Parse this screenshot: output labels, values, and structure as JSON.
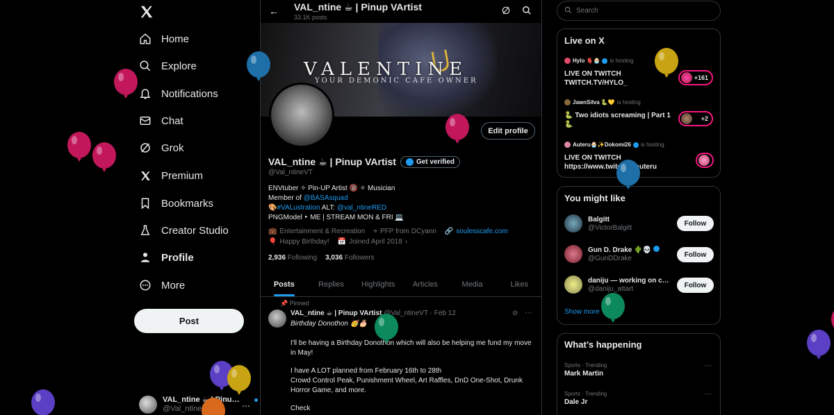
{
  "colors": {
    "accent": "#1d9bf0",
    "live": "#f91880",
    "bg": "#000000",
    "border": "#2f3336",
    "balloon_magenta": "#c2185b",
    "balloon_blue": "#1e6fa8",
    "balloon_yellow": "#c8a415",
    "balloon_green": "#0c8a5b",
    "balloon_purple": "#5b3fc4",
    "balloon_orange": "#d9691c"
  },
  "sidebar": {
    "logo_icon": "x-logo-icon",
    "items": [
      {
        "label": "Home",
        "icon": "home-icon"
      },
      {
        "label": "Explore",
        "icon": "search-icon"
      },
      {
        "label": "Notifications",
        "icon": "bell-icon"
      },
      {
        "label": "Chat",
        "icon": "mail-icon"
      },
      {
        "label": "Grok",
        "icon": "grok-icon"
      },
      {
        "label": "Premium",
        "icon": "x-logo-icon"
      },
      {
        "label": "Bookmarks",
        "icon": "bookmark-icon"
      },
      {
        "label": "Creator Studio",
        "icon": "flask-icon"
      },
      {
        "label": "Profile",
        "icon": "person-icon"
      },
      {
        "label": "More",
        "icon": "more-circle-icon"
      }
    ],
    "post_label": "Post",
    "account": {
      "name": "VAL_ntine ☕ | Pinu…",
      "handle": "@Val_ntineVT",
      "more": "⋯"
    }
  },
  "header": {
    "title": "VAL_ntine ☕ | Pinup VArtist",
    "subtitle": "33.1K posts",
    "back": "←"
  },
  "banner": {
    "title": "VALENTINE",
    "subtitle": "YOUR DEMONIC CAFE OWNER"
  },
  "profile": {
    "edit_label": "Edit profile",
    "name": "VAL_ntine ☕ | Pinup VArtist",
    "verify_label": "Get verified",
    "handle": "@Val_ntineVT",
    "bio": {
      "line1": "ENVtuber ✧ Pin-UP Artist 🔞 ✧ Musician",
      "line2_prefix": "Member of ",
      "line2_link": "@BASAsquad",
      "line3_icon": "🎨",
      "line3_tag": "#VALustration",
      "line3_mid": " ALT: ",
      "line3_link": "@val_ntineRED",
      "line4": "PNGModel ‣ ME | STREAM MON & FRI 💻"
    },
    "meta": {
      "category": "Entertainment & Recreation",
      "location": "PFP from DCyann",
      "website": "soulesscafe.com",
      "birthday": "Happy Birthday!",
      "joined": "Joined April 2018"
    },
    "following_count": "2,936",
    "following_label": "Following",
    "followers_count": "3,036",
    "followers_label": "Followers"
  },
  "tabs": [
    "Posts",
    "Replies",
    "Highlights",
    "Articles",
    "Media",
    "Likes"
  ],
  "pinned_post": {
    "pinned_label": "Pinned",
    "name": "VAL_ntine ☕ | Pinup VArtist",
    "meta": "@Val_ntineVT · Feb 12",
    "subtitle": "Birthday Donothon 🥳🎂",
    "paragraphs": [
      "I'll be having a Birthday Donothon which will also be helping me fund my move in May!",
      "I have A LOT planned from February 16th to 28th\nCrowd Control Peak, Punishment Wheel, Art Raffles, DnD One-Shot, Drunk Horror Game, and more.",
      "Check"
    ],
    "more": "⋯"
  },
  "right": {
    "search_placeholder": "Search",
    "live": {
      "title": "Live on X",
      "entries": [
        {
          "host": "Hylo 🫀🧁",
          "hosting": "is hosting",
          "title": "LIVE ON TWITCH TWITCH.TV/HYLO_",
          "count": "+161"
        },
        {
          "host": "JawnSilva 🐍💛",
          "hosting": "is hosting",
          "title": "🐍 Two idiots screaming | Part 1 🐍",
          "count": "+2"
        },
        {
          "host": "Auteru🧁✨Dokomi26",
          "hosting": "is hosting",
          "title": "LIVE ON TWITCH https://www.twitch.tv/auteru",
          "count": ""
        }
      ]
    },
    "suggest": {
      "title": "You might like",
      "users": [
        {
          "name": "Balgitt",
          "handle": "@VictorBalgitt",
          "button": "Follow"
        },
        {
          "name": "Gun D. Drake 🌵💀",
          "handle": "@GunDDrake",
          "button": "Follow"
        },
        {
          "name": "daniju — working on c…",
          "handle": "@daniju_attart",
          "button": "Follow"
        }
      ],
      "show_more": "Show more"
    },
    "trends": {
      "title": "What’s happening",
      "items": [
        {
          "category": "Sports · Trending",
          "name": "Mark Martin"
        },
        {
          "category": "Sports · Trending",
          "name": "Dale Jr"
        }
      ],
      "more": "⋯"
    }
  }
}
